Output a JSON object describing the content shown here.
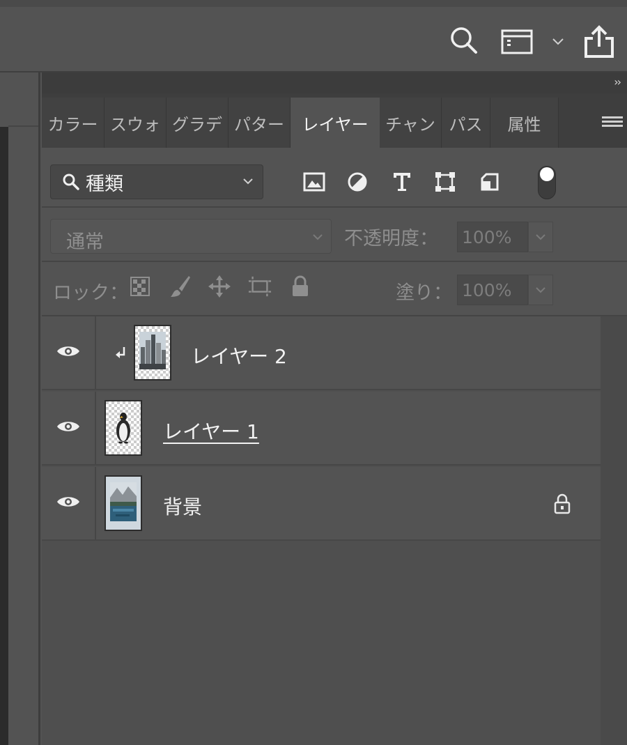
{
  "topbar": {
    "icons": [
      "search-icon",
      "workspace-icon",
      "chevron-down-icon",
      "share-icon"
    ]
  },
  "panel": {
    "collapse_icon": "double-chevron-right-icon",
    "tabs": [
      {
        "label": "カラー",
        "active": false
      },
      {
        "label": "スウォ",
        "active": false
      },
      {
        "label": "グラデ",
        "active": false
      },
      {
        "label": "パター",
        "active": false
      },
      {
        "label": "レイヤー",
        "active": true
      },
      {
        "label": "チャン",
        "active": false
      },
      {
        "label": "パス",
        "active": false
      },
      {
        "label": "属性",
        "active": false
      }
    ],
    "menu_icon": "hamburger-menu-icon"
  },
  "filter": {
    "kind_label": "種類",
    "icons": [
      "image-filter-icon",
      "adjustment-filter-icon",
      "type-filter-icon",
      "shape-filter-icon",
      "smart-object-filter-icon"
    ],
    "toggle_on": true
  },
  "blend": {
    "mode": "通常",
    "opacity_label": "不透明度：",
    "opacity_value": "100%"
  },
  "lock": {
    "label": "ロック：",
    "icons": [
      "lock-transparent-pixels-icon",
      "lock-image-pixels-icon",
      "lock-position-icon",
      "lock-artboard-icon",
      "lock-all-icon"
    ],
    "fill_label": "塗り：",
    "fill_value": "100%"
  },
  "layers": [
    {
      "name": "レイヤー 2",
      "visible": true,
      "clipped": true,
      "locked": false,
      "thumb": "city"
    },
    {
      "name": "レイヤー 1",
      "visible": true,
      "clipped": false,
      "locked": false,
      "thumb": "penguin"
    },
    {
      "name": "背景",
      "visible": true,
      "clipped": false,
      "locked": true,
      "thumb": "lake"
    }
  ],
  "colors": {
    "panel_bg": "#535353",
    "tab_bar": "#3e3e3e",
    "text": "#f2f2f2",
    "dim_text": "#8e8e8e"
  }
}
